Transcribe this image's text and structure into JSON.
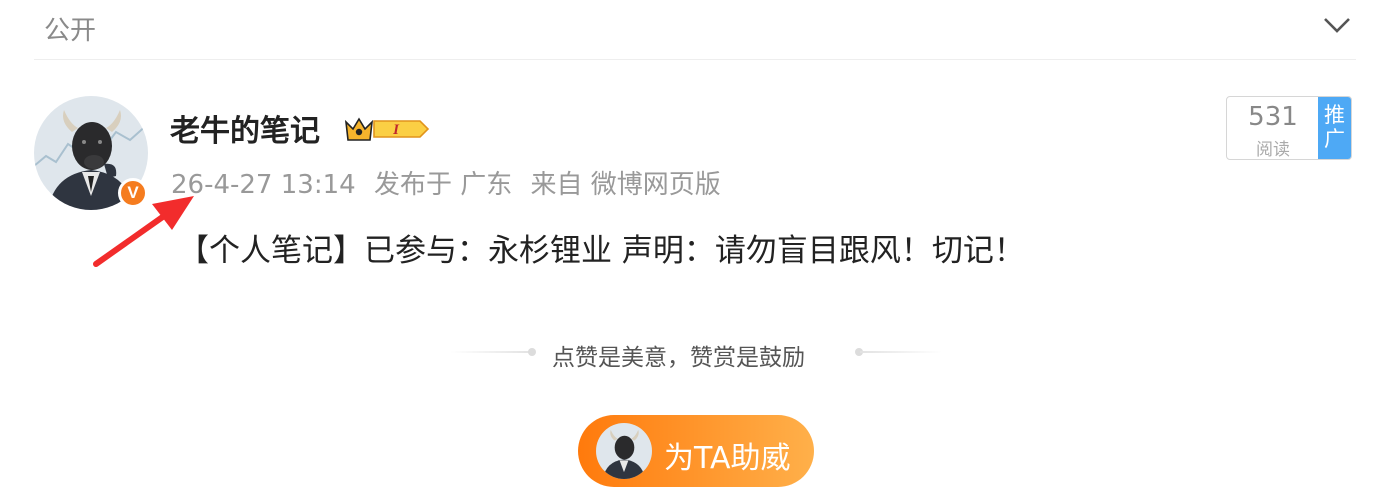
{
  "header": {
    "visibility": "公开"
  },
  "post": {
    "username": "老牛的笔记",
    "crown_badge_text": "I",
    "time": "26-4-27 13:14",
    "published_in": "发布于 广东",
    "source": "来自 微博网页版",
    "verified_mark": "V",
    "text": "【个人笔记】已参与：永杉锂业  声明：请勿盲目跟风！切记！"
  },
  "read_stats": {
    "count": "531",
    "label": "阅读",
    "promote": "推广"
  },
  "reward": {
    "slogan": "点赞是美意，赞赏是鼓励",
    "button_label": "为TA助威"
  },
  "colors": {
    "accent": "#ff8a1a",
    "promote": "#4ea9f5",
    "annotation_arrow": "#f22c2c"
  }
}
